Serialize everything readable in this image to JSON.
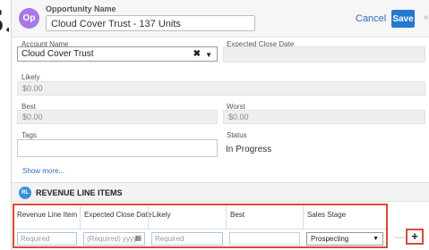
{
  "header": {
    "badge": "Op",
    "opportunity_label": "Opportunity Name",
    "opportunity_value": "Cloud Cover Trust - 137 Units",
    "cancel_label": "Cancel",
    "save_label": "Save",
    "collapse_glyph": "«"
  },
  "form": {
    "account_name_label": "Account Name",
    "account_name_value": "Cloud Cover Trust",
    "expected_close_label": "Expected Close Date",
    "likely_label": "Likely",
    "likely_value": "$0.00",
    "best_label": "Best",
    "best_value": "$0.00",
    "worst_label": "Worst",
    "worst_value": "$0.00",
    "tags_label": "Tags",
    "status_label": "Status",
    "status_value": "In Progress",
    "show_more": "Show more..."
  },
  "revenue": {
    "badge": "RL",
    "title": "REVENUE LINE ITEMS",
    "columns": [
      "Revenue Line Item",
      "Expected Close Date",
      "Likely",
      "Best",
      "Sales Stage"
    ],
    "row": {
      "item_placeholder": "Required",
      "date_placeholder": "(Required) yyyy",
      "likely_placeholder": "Required",
      "best_value": "",
      "sales_stage": "Prospecting"
    },
    "minus_glyph": "—",
    "plus_glyph": "+"
  },
  "colors": {
    "accent": "#2378d0",
    "op_badge": "#a679e5",
    "rl_badge": "#3a8fd9",
    "highlight": "#d84a38"
  }
}
